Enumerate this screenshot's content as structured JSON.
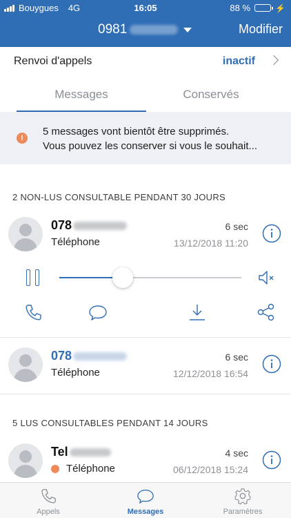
{
  "status_bar": {
    "carrier": "Bouygues",
    "network": "4G",
    "time": "16:05",
    "battery": "88 %",
    "battery_level": 0.88
  },
  "header": {
    "number_prefix": "0981",
    "modify_label": "Modifier"
  },
  "forwarding": {
    "label": "Renvoi d'appels",
    "state": "inactif"
  },
  "tabs": [
    {
      "label": "Messages",
      "active": true
    },
    {
      "label": "Conservés",
      "active": false
    }
  ],
  "warning": {
    "icon": "!",
    "line1": "5 messages vont bientôt être supprimés.",
    "line2": "Vous pouvez les conserver si vous le souhait..."
  },
  "sections": [
    {
      "title": "2 NON-LUS CONSULTABLE PENDANT 30 JOURS"
    },
    {
      "title": "5 LUS CONSULTABLES PENDANT 14 JOURS"
    }
  ],
  "messages": [
    {
      "name": "078",
      "type": "Téléphone",
      "duration": "6 sec",
      "date": "13/12/2018 11:20"
    },
    {
      "name": "078",
      "type": "Téléphone",
      "duration": "6 sec",
      "date": "12/12/2018 16:54"
    },
    {
      "name": "Tel",
      "type": "Téléphone",
      "duration": "4 sec",
      "date": "06/12/2018 15:24"
    }
  ],
  "player": {
    "progress": 0.35
  },
  "tabbar": [
    {
      "label": "Appels",
      "icon": "phone-icon",
      "active": false
    },
    {
      "label": "Messages",
      "icon": "chat-icon",
      "active": true
    },
    {
      "label": "Paramètres",
      "icon": "gear-icon",
      "active": false
    }
  ],
  "colors": {
    "brand": "#2f6db5",
    "warning": "#ee8a5a",
    "warning_bg": "#eef0f5"
  }
}
